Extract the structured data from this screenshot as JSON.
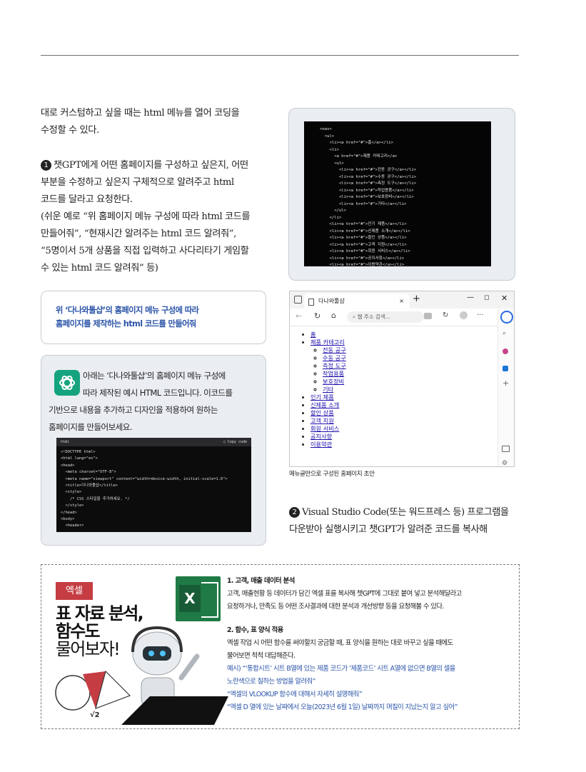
{
  "left_column": {
    "para1": [
      "대로 커스텀하고 싶을 때는 html 메뉴를 열어 코딩을",
      "수정할 수 있다."
    ],
    "step1_badge": "1",
    "step1_lines": [
      "챗GPT에게 어떤 홈페이지를 구성하고 싶은지, 어떤",
      "부분을 수정하고 싶은지 구체적으로 알려주고 html",
      "코드를 달라고 요청한다.",
      "(쉬운 예로 “위 홈페이지 메뉴 구성에 따라 html 코드를",
      "만들어줘”, “현재시간 알려주는 html 코드 알려줘”,",
      "“5명이서 5개 상품을 직접 입력하고 사다리타기 게임할",
      "수 있는 html 코드 알려줘” 등)"
    ]
  },
  "prompt_box": {
    "lines": [
      "위 ‘다나와툴샵’의 홈페이지 메뉴 구성에 따라",
      "홈페이지를 제작하는 html 코드를 만들어줘"
    ]
  },
  "answer_box": {
    "lines": [
      "아래는 ‘다나와툴샵’의 홈페이지 메뉴 구성에",
      "따라 제작된 예시 HTML 코드입니다. 이코드를",
      "기반으로 내용을 추가하고 디자인을 적용하여 원하는",
      "홈페이지를 만들어보세요."
    ],
    "code_header_left": "html",
    "code_header_right": "Copy code",
    "code_lines": [
      "<!DOCTYPE html>",
      "<html lang=\"en\">",
      "<head>",
      "  <meta charset=\"UTF-8\">",
      "  <meta name=\"viewport\" content=\"width=device-width, initial-scale=1.0\">",
      "  <title>다나와툴샵</title>",
      "  <style>",
      "    /* CSS 스타일을 추가하세요. */",
      "  </style>",
      "</head>",
      "<body>",
      "  <header>"
    ]
  },
  "html_code_screenshot": {
    "lines": [
      "<nav>",
      "  <ul>",
      "    <li><a href=\"#\">홈</a></li>",
      "    <li>",
      "      <a href=\"#\">제품 카테고리</a>",
      "      <ul>",
      "        <li><a href=\"#\">전동 공구</a></li>",
      "        <li><a href=\"#\">수동 공구</a></li>",
      "        <li><a href=\"#\">측정 도구</a></li>",
      "        <li><a href=\"#\">작업용품</a></li>",
      "        <li><a href=\"#\">보호장비</a></li>",
      "        <li><a href=\"#\">기타</a></li>",
      "      </ul>",
      "    </li>",
      "    <li><a href=\"#\">인기 제품</a></li>",
      "    <li><a href=\"#\">신제품 소개</a></li>",
      "    <li><a href=\"#\">할인 상품</a></li>",
      "    <li><a href=\"#\">고객 지원</a></li>",
      "    <li><a href=\"#\">회원 서비스</a></li>",
      "    <li><a href=\"#\">공지사항</a></li>",
      "    <li><a href=\"#\">이용약관</a></li>"
    ]
  },
  "browser": {
    "tab_title": "다나와툴샵",
    "tab_close": "×",
    "new_tab": "+",
    "address_placeholder": "웹 주소 검색...",
    "menu": [
      {
        "label": "홈",
        "children": []
      },
      {
        "label": "제품 카테고리",
        "children": [
          "전동 공구",
          "수동 공구",
          "측정 도구",
          "작업용품",
          "보호장비",
          "기타"
        ]
      },
      {
        "label": "인기 제품",
        "children": []
      },
      {
        "label": "신제품 소개",
        "children": []
      },
      {
        "label": "할인 상품",
        "children": []
      },
      {
        "label": "고객 지원",
        "children": []
      },
      {
        "label": "회원 서비스",
        "children": []
      },
      {
        "label": "공지사항",
        "children": []
      },
      {
        "label": "이용약관",
        "children": []
      }
    ],
    "caption": "메뉴글만으로 구성된 홈페이지 초안"
  },
  "step2": {
    "badge": "2",
    "lines": [
      "Visual Studio Code(또는 워드프레스 등) 프로그램을",
      "다운받아 실행시키고 챗GPT가 알려준 코드를 복사해"
    ]
  },
  "ad": {
    "tag": "엑셀",
    "title_lines": [
      "표 자료 분석,",
      "함수도",
      "물어보자!"
    ],
    "excel_letter": "X",
    "sqrt_label": "√2",
    "section1_title": "1. 고객, 매출 데이터 분석",
    "section1_body": [
      "고객, 매출현황 등 데이터가 담긴 엑셀 표를 복사해 챗GPT에 그대로 붙여 넣고 분석해달라고",
      "요청하거나, 만족도 등 어떤 조사결과에 대한 분석과 개선방향 등을 요청해볼 수 있다."
    ],
    "section2_title": "2. 함수, 표 양식 적용",
    "section2_body": [
      "엑셀 작업 시 어떤 함수를 써야할지 궁금할 때, 표 양식을 원하는 대로 바꾸고 싶을 때에도",
      "물어보면 척척 대답해준다."
    ],
    "examples": [
      "예시) “‘통합시트’ 시트 B열에 있는 제품 코드가 ‘제품코드’ 시트 A열에 없으면 B열의 셀을",
      "노란색으로 칠하는 방법을 알려줘”",
      "“엑셀의 VLOOKUP 함수에 대해서 자세히 설명해줘”",
      "“엑셀 D 열에 있는 날짜에서 오늘(2023년 6월 1일) 날짜까지 며칠이 지났는지 알고 싶어”"
    ]
  }
}
